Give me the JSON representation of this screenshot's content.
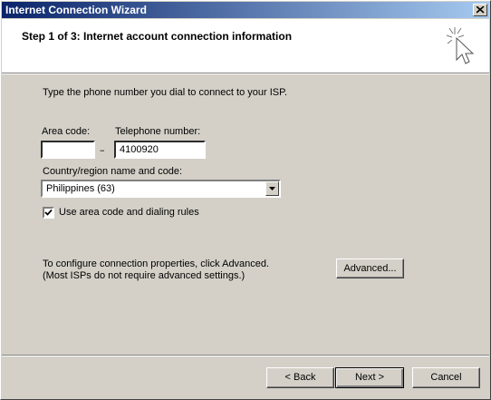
{
  "window": {
    "title": "Internet Connection Wizard",
    "close_symbol": "×"
  },
  "header": {
    "step_title": "Step 1 of 3: Internet account connection information",
    "icon": "wizard-cursor-icon"
  },
  "main": {
    "instruction": "Type the phone number you dial to connect to your ISP.",
    "area_code_label": "Area code:",
    "area_code_value": "",
    "dash": "–",
    "phone_label": "Telephone number:",
    "phone_value": "4100920",
    "country_label": "Country/region name and code:",
    "country_value": "Philippines (63)",
    "checkbox_label": "Use area code and dialing rules",
    "checkbox_checked": true,
    "advanced_text_1": "To configure connection properties, click Advanced.",
    "advanced_text_2": "(Most ISPs do not require advanced settings.)",
    "advanced_button": "Advanced..."
  },
  "footer": {
    "back_label": "< Back",
    "next_label": "Next >",
    "cancel_label": "Cancel"
  },
  "colors": {
    "titlebar_start": "#0a246a",
    "titlebar_end": "#a6caf0",
    "face": "#d4d0c8"
  }
}
